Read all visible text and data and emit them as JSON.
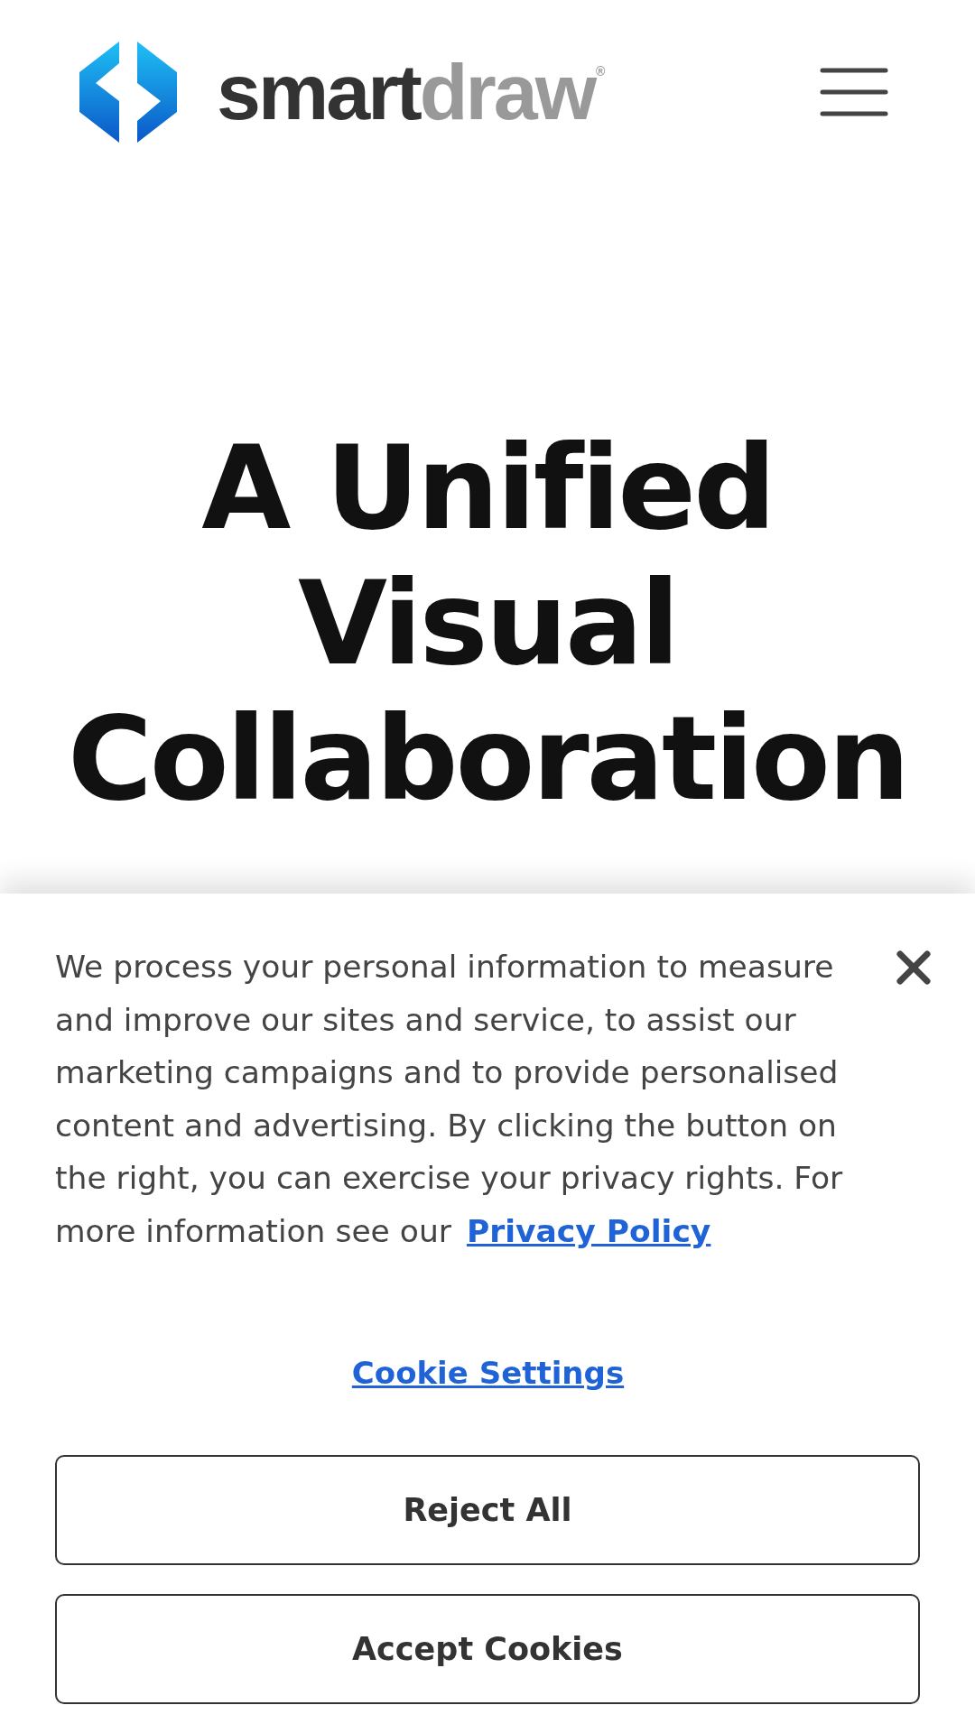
{
  "header": {
    "logo_dark": "smart",
    "logo_light": "draw",
    "logo_mark": "®"
  },
  "hero": {
    "title": "A Unified Visual Collaboration"
  },
  "cookie_banner": {
    "message": "We process your personal information to measure and improve our sites and service, to assist our marketing campaigns and to provide personalised content and advertising. By clicking the button on the right, you can exercise your privacy rights. For more information see our",
    "policy_link": "Privacy Policy",
    "settings_link": "Cookie Settings",
    "buttons": [
      "Reject All",
      "Accept Cookies"
    ]
  }
}
